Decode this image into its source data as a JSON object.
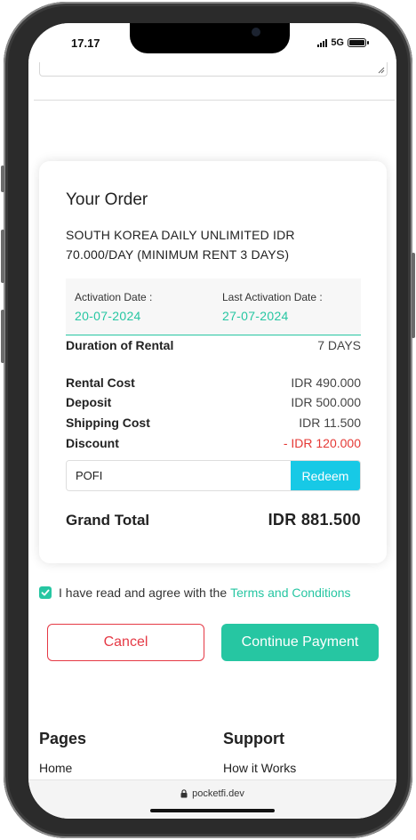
{
  "status_bar": {
    "time": "17.17",
    "network": "5G",
    "icons": [
      "signal-icon",
      "battery-icon"
    ]
  },
  "order": {
    "title": "Your Order",
    "product_name": "SOUTH KOREA DAILY UNLIMITED IDR 70.000/DAY (MINIMUM RENT 3 DAYS)",
    "activation_date_label": "Activation Date :",
    "activation_date": "20-07-2024",
    "last_activation_date_label": "Last Activation Date :",
    "last_activation_date": "27-07-2024",
    "duration_label": "Duration of Rental",
    "duration_value": "7 DAYS",
    "rental_cost_label": "Rental Cost",
    "rental_cost": "IDR 490.000",
    "deposit_label": "Deposit",
    "deposit": "IDR 500.000",
    "shipping_label": "Shipping Cost",
    "shipping": "IDR 11.500",
    "discount_label": "Discount",
    "discount": "- IDR 120.000",
    "promo_code": "POFI",
    "redeem_label": "Redeem",
    "grand_total_label": "Grand Total",
    "grand_total": "IDR 881.500"
  },
  "agreement": {
    "checked": true,
    "text": "I have read and agree with the",
    "link": "Terms and Conditions"
  },
  "actions": {
    "cancel_label": "Cancel",
    "continue_label": "Continue Payment"
  },
  "footer": {
    "pages_heading": "Pages",
    "pages_links": [
      "Home"
    ],
    "support_heading": "Support",
    "support_links": [
      "How it Works"
    ]
  },
  "browser": {
    "url": "pocketfi.dev"
  },
  "colors": {
    "accent": "#26c6a2",
    "redeem": "#17c9e6",
    "danger": "#e53945"
  }
}
